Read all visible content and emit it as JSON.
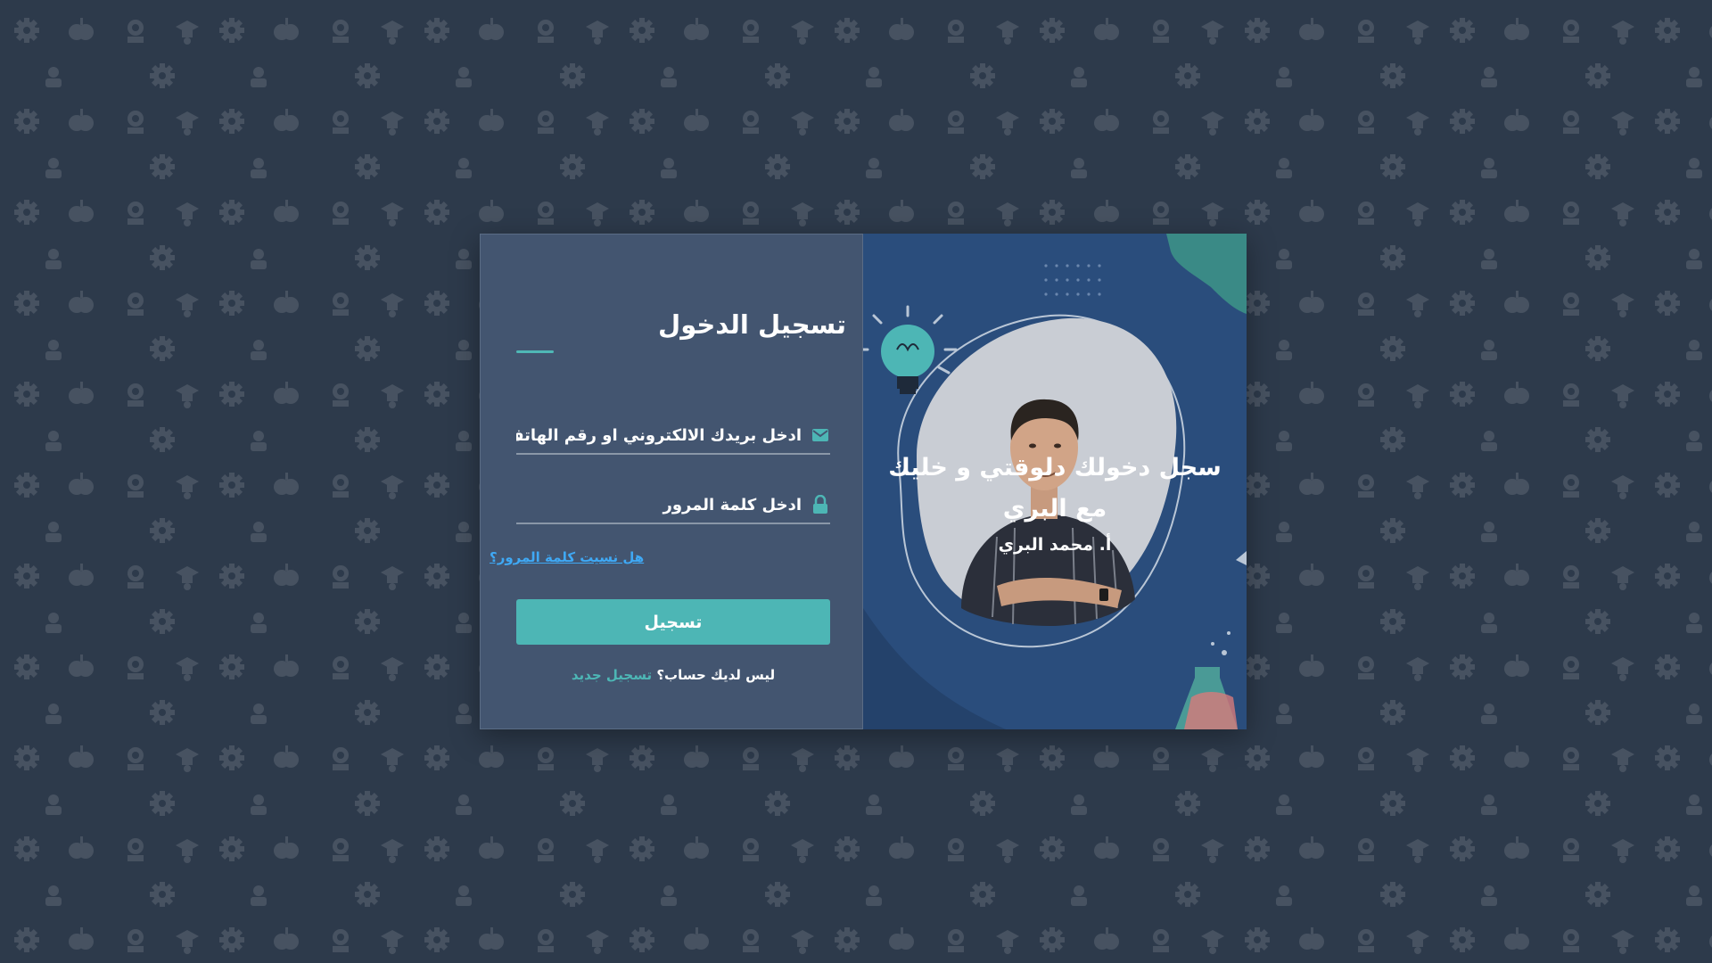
{
  "login_form": {
    "title": "تسجيل الدخول",
    "email_placeholder": "ادخل بريدك الالكتروني او رقم الهاتف",
    "password_placeholder": "ادخل كلمة المرور",
    "forgot_password": "هل نسيت كلمة المرور؟",
    "submit_label": "تسجيل",
    "no_account_text": "ليس لديك حساب؟",
    "signup_link": "تسجيل جديد"
  },
  "promo": {
    "headline": "سجل دخولك دلوقتي و خليك مع البري",
    "author": "أ. محمد البري"
  },
  "icons": {
    "email": "envelope-icon",
    "password": "lock-icon",
    "background_pattern": [
      "gear-icon",
      "apple-icon",
      "badge-icon",
      "graduation-cap-icon",
      "teacher-icon"
    ]
  },
  "colors": {
    "page_background": "#2d3a4b",
    "form_panel": "#435570",
    "accent": "#4db6b5",
    "link": "#3fa9f5",
    "image_panel": "#2a4d7c"
  }
}
